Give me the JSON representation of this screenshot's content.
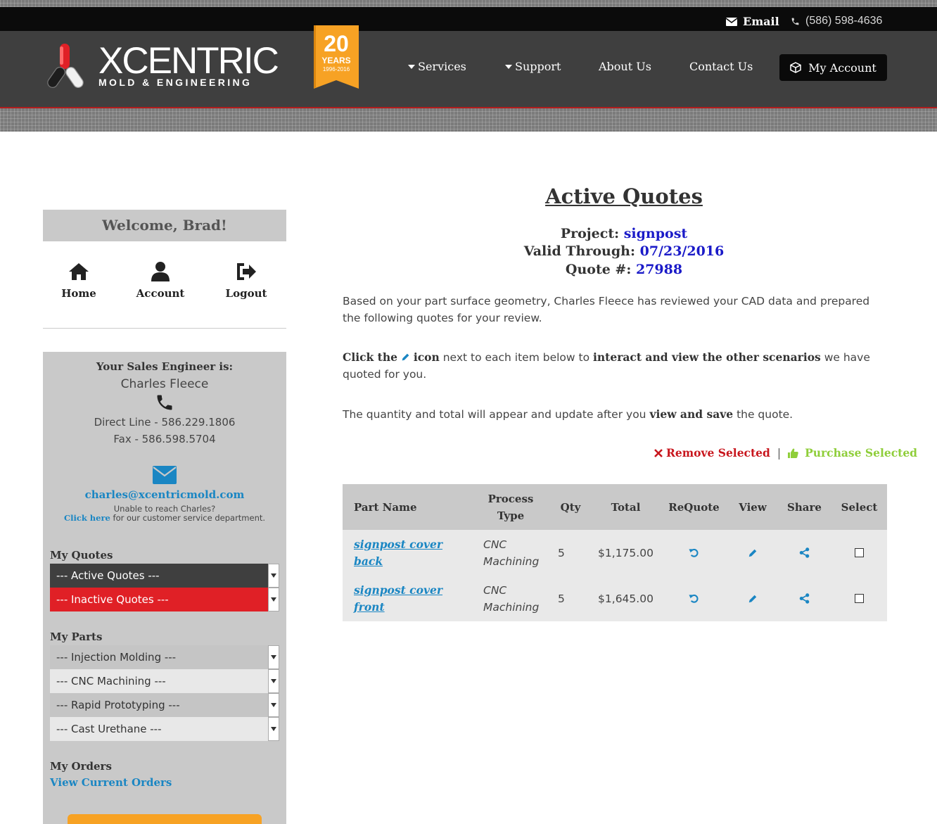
{
  "header": {
    "email_label": "Email",
    "phone": "(586) 598-4636",
    "logo_word": "XCENTRIC",
    "logo_sub": "MOLD & ENGINEERING",
    "ribbon_number": "20",
    "ribbon_years": "YEARS",
    "ribbon_range": "1996-2016",
    "nav": {
      "services": "Services",
      "support": "Support",
      "about": "About Us",
      "contact": "Contact Us",
      "my_account": "My Account"
    }
  },
  "sidebar": {
    "welcome": "Welcome, Brad!",
    "quicknav": {
      "home": "Home",
      "account": "Account",
      "logout": "Logout"
    },
    "sales_engineer": {
      "title": "Your Sales Engineer is:",
      "name": "Charles Fleece",
      "direct_line": "Direct Line - 586.229.1806",
      "fax": "Fax - 586.598.5704",
      "email": "charles@xcentricmold.com",
      "unable": "Unable to reach Charles?",
      "click_here": "Click here",
      "click_rest": " for our customer service department."
    },
    "my_quotes": {
      "heading": "My Quotes",
      "active": "--- Active Quotes ---",
      "inactive": "--- Inactive Quotes ---"
    },
    "my_parts": {
      "heading": "My Parts",
      "injection": "--- Injection Molding ---",
      "cnc": "--- CNC Machining ---",
      "rapid": "--- Rapid Prototyping ---",
      "cast": "--- Cast Urethane ---"
    },
    "my_orders": {
      "heading": "My Orders",
      "link": "View Current Orders"
    }
  },
  "main": {
    "title": "Active Quotes",
    "project_label": "Project:",
    "project_value": "signpost",
    "valid_label": "Valid Through:",
    "valid_value": "07/23/2016",
    "quote_label": "Quote #:",
    "quote_value": "27988",
    "intro": "Based on your part surface geometry, Charles Fleece has reviewed your CAD data and prepared the following quotes for your review.",
    "click_a": "Click the",
    "click_b": "icon",
    "click_c": "next to each item below to",
    "click_d": "interact and view the other scenarios",
    "click_e": "we have quoted for you.",
    "qty_a": "The quantity and total will appear and update after you",
    "qty_b": "view and save",
    "qty_c": "the quote.",
    "remove_selected": "Remove Selected",
    "pipe": "|",
    "purchase_selected": "Purchase Selected",
    "table": {
      "headers": {
        "part": "Part Name",
        "process1": "Process",
        "process2": "Type",
        "qty": "Qty",
        "total": "Total",
        "requote": "ReQuote",
        "view": "View",
        "share": "Share",
        "select": "Select"
      },
      "rows": [
        {
          "part1": "signpost cover",
          "part2": "back",
          "type1": "CNC",
          "type2": "Machining",
          "qty": "5",
          "total": "$1,175.00"
        },
        {
          "part1": "signpost cover",
          "part2": "front",
          "type1": "CNC",
          "type2": "Machining",
          "qty": "5",
          "total": "$1,645.00"
        }
      ]
    }
  },
  "colors": {
    "accent_blue": "#1a86c3",
    "value_blue": "#1a1ac8",
    "danger_red": "#c8161d",
    "success_green": "#8fce3a",
    "brand_orange": "#f7a224"
  },
  "icons": [
    "envelope-icon",
    "phone-icon",
    "cube-icon",
    "home-icon",
    "user-icon",
    "logout-icon",
    "times-icon",
    "thumbs-up-icon",
    "undo-icon",
    "pencil-icon",
    "share-icon"
  ]
}
